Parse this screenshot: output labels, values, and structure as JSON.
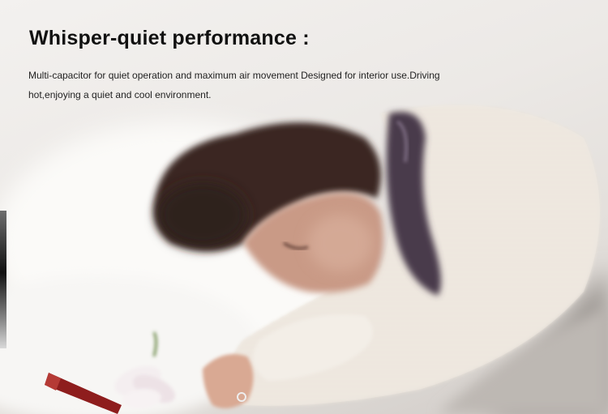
{
  "banner": {
    "headline": "Whisper-quiet performance :",
    "description": "Multi-capacitor for quiet operation and maximum air movement Designed for interior use.Driving hot,enjoying a quiet and cool environment."
  },
  "photo": {
    "subject": "sleeping-woman-illustration",
    "colors": {
      "hair": "#3a2722",
      "skin": "#c99a86",
      "sweater": "#f1ece4",
      "bedding": "#f5f4f2",
      "scarf": "#4a3a4c",
      "lipstick": "#8e1d1d",
      "flower": "#f4eef0"
    }
  }
}
